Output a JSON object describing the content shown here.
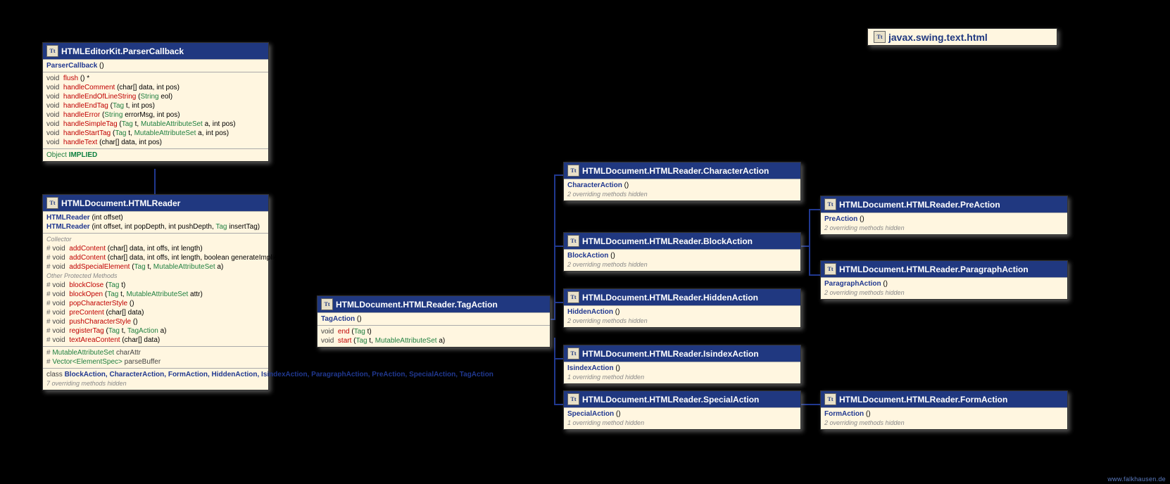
{
  "package_title": "javax.swing.text.html",
  "boxes": {
    "parserCallback": {
      "title": "HTMLEditorKit.ParserCallback",
      "ctor": "ParserCallback",
      "methods": [
        {
          "ret": "void",
          "name": "flush",
          "params": "()",
          "extra": " *"
        },
        {
          "ret": "void",
          "name": "handleComment",
          "params": "(char[] data, int pos)"
        },
        {
          "ret": "void",
          "name": "handleEndOfLineString",
          "params": "(String eol)",
          "types": [
            "String"
          ]
        },
        {
          "ret": "void",
          "name": "handleEndTag",
          "params": "(Tag t, int pos)",
          "types": [
            "Tag"
          ]
        },
        {
          "ret": "void",
          "name": "handleError",
          "params": "(String errorMsg, int pos)",
          "types": [
            "String"
          ]
        },
        {
          "ret": "void",
          "name": "handleSimpleTag",
          "params": "(Tag t, MutableAttributeSet a, int pos)",
          "types": [
            "Tag",
            "MutableAttributeSet"
          ]
        },
        {
          "ret": "void",
          "name": "handleStartTag",
          "params": "(Tag t, MutableAttributeSet a, int pos)",
          "types": [
            "Tag",
            "MutableAttributeSet"
          ]
        },
        {
          "ret": "void",
          "name": "handleText",
          "params": "(char[] data, int pos)"
        }
      ],
      "field_type": "Object",
      "field_name": "IMPLIED"
    },
    "htmlReader": {
      "title": "HTMLDocument.HTMLReader",
      "ctors": [
        {
          "name": "HTMLReader",
          "params": "(int offset)"
        },
        {
          "name": "HTMLReader",
          "params": "(int offset, int popDepth, int pushDepth, Tag insertTag)",
          "types": [
            "Tag"
          ]
        }
      ],
      "group1_label": "Collector",
      "group2_label": "Other Protected Methods",
      "methods1": [
        {
          "ret": "void",
          "name": "addContent",
          "params": "(char[] data, int offs, int length)"
        },
        {
          "ret": "void",
          "name": "addContent",
          "params": "(char[] data, int offs, int length,\n                boolean generateImpliedPIfNecessary)"
        },
        {
          "ret": "void",
          "name": "addSpecialElement",
          "params": "(Tag t, MutableAttributeSet a)",
          "types": [
            "Tag",
            "MutableAttributeSet"
          ]
        }
      ],
      "methods2": [
        {
          "ret": "void",
          "name": "blockClose",
          "params": "(Tag t)",
          "types": [
            "Tag"
          ]
        },
        {
          "ret": "void",
          "name": "blockOpen",
          "params": "(Tag t, MutableAttributeSet attr)",
          "types": [
            "Tag",
            "MutableAttributeSet"
          ]
        },
        {
          "ret": "void",
          "name": "popCharacterStyle",
          "params": "()"
        },
        {
          "ret": "void",
          "name": "preContent",
          "params": "(char[] data)"
        },
        {
          "ret": "void",
          "name": "pushCharacterStyle",
          "params": "()"
        },
        {
          "ret": "void",
          "name": "registerTag",
          "params": "(Tag t, TagAction a)",
          "types": [
            "Tag",
            "TagAction"
          ]
        },
        {
          "ret": "void",
          "name": "textAreaContent",
          "params": "(char[] data)"
        }
      ],
      "fields": [
        {
          "type": "MutableAttributeSet",
          "name": "charAttr"
        },
        {
          "type": "Vector<ElementSpec>",
          "name": "parseBuffer"
        }
      ],
      "inner_label": "class",
      "inner_classes": "BlockAction, CharacterAction, FormAction, HiddenAction, IsindexAction, ParagraphAction, PreAction, SpecialAction, TagAction",
      "override_note": "7 overriding methods hidden"
    },
    "tagAction": {
      "title": "HTMLDocument.HTMLReader.TagAction",
      "ctor": "TagAction",
      "methods": [
        {
          "ret": "void",
          "name": "end",
          "params": "(Tag t)",
          "types": [
            "Tag"
          ]
        },
        {
          "ret": "void",
          "name": "start",
          "params": "(Tag t, MutableAttributeSet a)",
          "types": [
            "Tag",
            "MutableAttributeSet"
          ]
        }
      ]
    },
    "characterAction": {
      "title": "HTMLDocument.HTMLReader.CharacterAction",
      "ctor": "CharacterAction",
      "note": "2 overriding methods hidden"
    },
    "blockAction": {
      "title": "HTMLDocument.HTMLReader.BlockAction",
      "ctor": "BlockAction",
      "note": "2 overriding methods hidden"
    },
    "hiddenAction": {
      "title": "HTMLDocument.HTMLReader.HiddenAction",
      "ctor": "HiddenAction",
      "note": "2 overriding methods hidden"
    },
    "isindexAction": {
      "title": "HTMLDocument.HTMLReader.IsindexAction",
      "ctor": "IsindexAction",
      "note": "1 overriding method hidden"
    },
    "specialAction": {
      "title": "HTMLDocument.HTMLReader.SpecialAction",
      "ctor": "SpecialAction",
      "note": "1 overriding method hidden"
    },
    "preAction": {
      "title": "HTMLDocument.HTMLReader.PreAction",
      "ctor": "PreAction",
      "note": "2 overriding methods hidden"
    },
    "paragraphAction": {
      "title": "HTMLDocument.HTMLReader.ParagraphAction",
      "ctor": "ParagraphAction",
      "note": "2 overriding methods hidden"
    },
    "formAction": {
      "title": "HTMLDocument.HTMLReader.FormAction",
      "ctor": "FormAction",
      "note": "2 overriding methods hidden"
    }
  },
  "footer": "www.falkhausen.de",
  "chart_data": {
    "type": "class-hierarchy-diagram",
    "package": "javax.swing.text.html",
    "edges": [
      {
        "from": "HTMLEditorKit.ParserCallback",
        "to": "HTMLDocument.HTMLReader",
        "kind": "extends"
      },
      {
        "from": "HTMLDocument.HTMLReader.TagAction",
        "to": "HTMLDocument.HTMLReader.CharacterAction",
        "kind": "extends"
      },
      {
        "from": "HTMLDocument.HTMLReader.TagAction",
        "to": "HTMLDocument.HTMLReader.BlockAction",
        "kind": "extends"
      },
      {
        "from": "HTMLDocument.HTMLReader.TagAction",
        "to": "HTMLDocument.HTMLReader.HiddenAction",
        "kind": "extends"
      },
      {
        "from": "HTMLDocument.HTMLReader.TagAction",
        "to": "HTMLDocument.HTMLReader.IsindexAction",
        "kind": "extends"
      },
      {
        "from": "HTMLDocument.HTMLReader.TagAction",
        "to": "HTMLDocument.HTMLReader.SpecialAction",
        "kind": "extends"
      },
      {
        "from": "HTMLDocument.HTMLReader.BlockAction",
        "to": "HTMLDocument.HTMLReader.PreAction",
        "kind": "extends"
      },
      {
        "from": "HTMLDocument.HTMLReader.BlockAction",
        "to": "HTMLDocument.HTMLReader.ParagraphAction",
        "kind": "extends"
      },
      {
        "from": "HTMLDocument.HTMLReader.SpecialAction",
        "to": "HTMLDocument.HTMLReader.FormAction",
        "kind": "extends"
      }
    ]
  }
}
